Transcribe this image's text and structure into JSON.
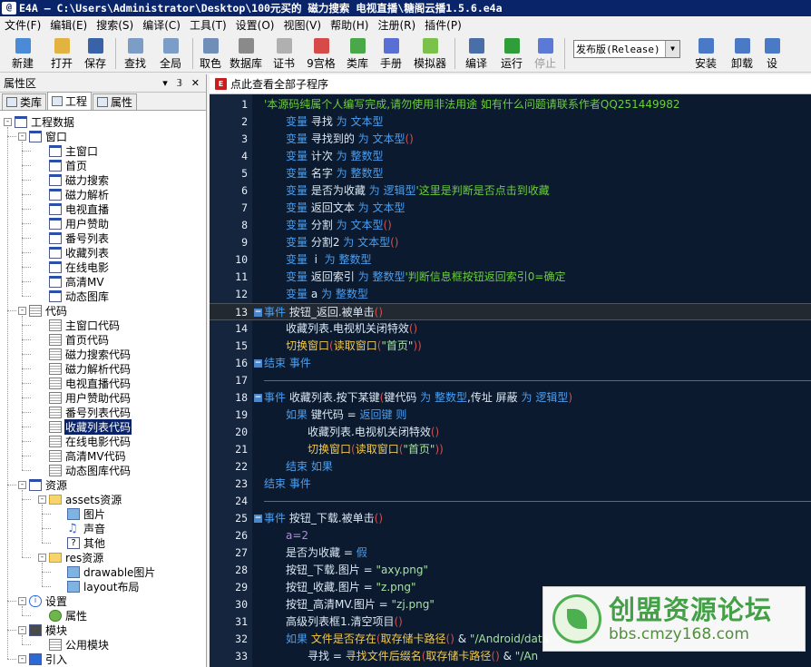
{
  "window": {
    "title": "E4A — C:\\Users\\Administrator\\Desktop\\100元买的 磁力搜索 电视直播\\糖阁云播1.5.6.e4a",
    "app_badge": "@"
  },
  "menu": [
    "文件(F)",
    "编辑(E)",
    "搜索(S)",
    "编译(C)",
    "工具(T)",
    "设置(O)",
    "视图(V)",
    "帮助(H)",
    "注册(R)",
    "插件(P)"
  ],
  "toolbar": {
    "buttons": [
      {
        "label": "新建",
        "icon": "new-file-icon",
        "color": "#4a8ad6"
      },
      {
        "label": "打开",
        "icon": "open-folder-icon",
        "color": "#e3b341"
      },
      {
        "label": "保存",
        "icon": "save-icon",
        "color": "#3a62a8"
      },
      {
        "label": "查找",
        "icon": "search-icon",
        "color": "#7c9ec6"
      },
      {
        "label": "全局",
        "icon": "global-search-icon",
        "color": "#7c9ec6"
      },
      {
        "label": "取色",
        "icon": "color-picker-icon",
        "color": "#6f8fb8"
      },
      {
        "label": "数据库",
        "icon": "database-icon",
        "color": "#8a8a8a"
      },
      {
        "label": "证书",
        "icon": "certificate-icon",
        "color": "#b0b0b0"
      },
      {
        "label": "9宫格",
        "icon": "nine-grid-icon",
        "color": "#d64a4a"
      },
      {
        "label": "类库",
        "icon": "library-icon",
        "color": "#4aa84a"
      },
      {
        "label": "手册",
        "icon": "manual-icon",
        "color": "#5a6fd6"
      },
      {
        "label": "模拟器",
        "icon": "android-icon",
        "color": "#7cc24a"
      },
      {
        "label": "编译",
        "icon": "compile-icon",
        "color": "#4a6fa8"
      },
      {
        "label": "运行",
        "icon": "run-icon",
        "color": "#2f9e3a"
      },
      {
        "label": "停止",
        "icon": "stop-icon",
        "color": "#5a7ad6",
        "disabled": true
      }
    ],
    "config_select": "发布版(Release)",
    "right_buttons": [
      {
        "label": "安装",
        "icon": "install-icon",
        "color": "#4a7ac6"
      },
      {
        "label": "卸载",
        "icon": "uninstall-icon",
        "color": "#4a7ac6"
      },
      {
        "label": "设",
        "icon": "settings-icon",
        "color": "#4a7ac6"
      }
    ]
  },
  "left_panel": {
    "title": "属性区",
    "header_controls": "▾ 𝟛 ✕",
    "tabs": [
      "类库",
      "工程",
      "属性"
    ],
    "tree": [
      {
        "label": "工程数据",
        "depth": 0,
        "icon": "project-icon",
        "expander": "-"
      },
      {
        "label": "窗口",
        "depth": 1,
        "icon": "window-icon",
        "expander": "-"
      },
      {
        "label": "主窗口",
        "depth": 2,
        "icon": "window-icon"
      },
      {
        "label": "首页",
        "depth": 2,
        "icon": "window-icon"
      },
      {
        "label": "磁力搜索",
        "depth": 2,
        "icon": "window-icon"
      },
      {
        "label": "磁力解析",
        "depth": 2,
        "icon": "window-icon"
      },
      {
        "label": "电视直播",
        "depth": 2,
        "icon": "window-icon"
      },
      {
        "label": "用户赞助",
        "depth": 2,
        "icon": "window-icon"
      },
      {
        "label": "番号列表",
        "depth": 2,
        "icon": "window-icon"
      },
      {
        "label": "收藏列表",
        "depth": 2,
        "icon": "window-icon"
      },
      {
        "label": "在线电影",
        "depth": 2,
        "icon": "window-icon"
      },
      {
        "label": "高清MV",
        "depth": 2,
        "icon": "window-icon"
      },
      {
        "label": "动态图库",
        "depth": 2,
        "icon": "window-icon"
      },
      {
        "label": "代码",
        "depth": 1,
        "icon": "code-icon",
        "expander": "-"
      },
      {
        "label": "主窗口代码",
        "depth": 2,
        "icon": "document-icon"
      },
      {
        "label": "首页代码",
        "depth": 2,
        "icon": "document-icon"
      },
      {
        "label": "磁力搜索代码",
        "depth": 2,
        "icon": "document-icon"
      },
      {
        "label": "磁力解析代码",
        "depth": 2,
        "icon": "document-icon"
      },
      {
        "label": "电视直播代码",
        "depth": 2,
        "icon": "document-icon"
      },
      {
        "label": "用户赞助代码",
        "depth": 2,
        "icon": "document-icon"
      },
      {
        "label": "番号列表代码",
        "depth": 2,
        "icon": "document-icon"
      },
      {
        "label": "收藏列表代码",
        "depth": 2,
        "icon": "document-icon",
        "selected": true
      },
      {
        "label": "在线电影代码",
        "depth": 2,
        "icon": "document-icon"
      },
      {
        "label": "高清MV代码",
        "depth": 2,
        "icon": "document-icon"
      },
      {
        "label": "动态图库代码",
        "depth": 2,
        "icon": "document-icon"
      },
      {
        "label": "资源",
        "depth": 1,
        "icon": "resource-icon",
        "expander": "-"
      },
      {
        "label": "assets资源",
        "depth": 2,
        "icon": "folder-icon",
        "expander": "-"
      },
      {
        "label": "图片",
        "depth": 3,
        "icon": "image-icon"
      },
      {
        "label": "声音",
        "depth": 3,
        "icon": "sound-icon"
      },
      {
        "label": "其他",
        "depth": 3,
        "icon": "question-icon"
      },
      {
        "label": "res资源",
        "depth": 2,
        "icon": "folder-icon",
        "expander": "-"
      },
      {
        "label": "drawable图片",
        "depth": 3,
        "icon": "image-icon"
      },
      {
        "label": "layout布局",
        "depth": 3,
        "icon": "layout-icon"
      },
      {
        "label": "设置",
        "depth": 1,
        "icon": "info-icon",
        "expander": "-"
      },
      {
        "label": "属性",
        "depth": 2,
        "icon": "gear-icon"
      },
      {
        "label": "模块",
        "depth": 1,
        "icon": "module-icon",
        "expander": "-"
      },
      {
        "label": "公用模块",
        "depth": 2,
        "icon": "document-icon"
      },
      {
        "label": "引入",
        "depth": 1,
        "icon": "import-icon",
        "expander": "-"
      }
    ]
  },
  "editor": {
    "link_text": "点此查看全部子程序",
    "lines": [
      {
        "n": "1",
        "indent": 0,
        "tokens": [
          [
            "c",
            "'本源码纯属个人编写完成,请勿使用非法用途 如有什么问题请联系作者QQ251449982"
          ]
        ]
      },
      {
        "n": "2",
        "indent": 1,
        "tokens": [
          [
            "k",
            "变量 "
          ],
          [
            "n",
            "寻找 "
          ],
          [
            "k",
            "为 "
          ],
          [
            "t",
            "文本型"
          ]
        ]
      },
      {
        "n": "3",
        "indent": 1,
        "tokens": [
          [
            "k",
            "变量 "
          ],
          [
            "n",
            "寻找到的 "
          ],
          [
            "k",
            "为 "
          ],
          [
            "t",
            "文本型"
          ],
          [
            "o",
            "()"
          ]
        ]
      },
      {
        "n": "4",
        "indent": 1,
        "tokens": [
          [
            "k",
            "变量 "
          ],
          [
            "n",
            "计次 "
          ],
          [
            "k",
            "为 "
          ],
          [
            "t",
            "整数型"
          ]
        ]
      },
      {
        "n": "5",
        "indent": 1,
        "tokens": [
          [
            "k",
            "变量 "
          ],
          [
            "n",
            "名字 "
          ],
          [
            "k",
            "为 "
          ],
          [
            "t",
            "整数型"
          ]
        ]
      },
      {
        "n": "6",
        "indent": 1,
        "tokens": [
          [
            "k",
            "变量 "
          ],
          [
            "n",
            "是否为收藏 "
          ],
          [
            "k",
            "为 "
          ],
          [
            "t",
            "逻辑型"
          ],
          [
            "c",
            "'这里是判断是否点击到收藏"
          ]
        ]
      },
      {
        "n": "7",
        "indent": 1,
        "tokens": [
          [
            "k",
            "变量 "
          ],
          [
            "n",
            "返回文本 "
          ],
          [
            "k",
            "为 "
          ],
          [
            "t",
            "文本型"
          ]
        ]
      },
      {
        "n": "8",
        "indent": 1,
        "tokens": [
          [
            "k",
            "变量 "
          ],
          [
            "n",
            "分割 "
          ],
          [
            "k",
            "为 "
          ],
          [
            "t",
            "文本型"
          ],
          [
            "o",
            "()"
          ]
        ]
      },
      {
        "n": "9",
        "indent": 1,
        "tokens": [
          [
            "k",
            "变量 "
          ],
          [
            "n",
            "分割2 "
          ],
          [
            "k",
            "为 "
          ],
          [
            "t",
            "文本型"
          ],
          [
            "o",
            "()"
          ]
        ]
      },
      {
        "n": "10",
        "indent": 1,
        "tokens": [
          [
            "k",
            "变量 "
          ],
          [
            "n",
            " i  "
          ],
          [
            "k",
            "为 "
          ],
          [
            "t",
            "整数型"
          ]
        ]
      },
      {
        "n": "11",
        "indent": 1,
        "tokens": [
          [
            "k",
            "变量 "
          ],
          [
            "n",
            "返回索引 "
          ],
          [
            "k",
            "为 "
          ],
          [
            "t",
            "整数型"
          ],
          [
            "c",
            "'判断信息框按钮返回索引0=确定"
          ]
        ]
      },
      {
        "n": "12",
        "indent": 1,
        "tokens": [
          [
            "k",
            "变量 "
          ],
          [
            "n",
            "a "
          ],
          [
            "k",
            "为 "
          ],
          [
            "t",
            "整数型"
          ]
        ]
      },
      {
        "n": "13",
        "indent": 0,
        "fold": "−",
        "highlight": true,
        "tokens": [
          [
            "k",
            "事件 "
          ],
          [
            "n",
            "按钮_返回.被单击"
          ],
          [
            "o",
            "()"
          ]
        ]
      },
      {
        "n": "14",
        "indent": 1,
        "tokens": [
          [
            "n",
            "收藏列表.电视机关闭特效"
          ],
          [
            "o",
            "()"
          ]
        ]
      },
      {
        "n": "15",
        "indent": 1,
        "tokens": [
          [
            "y",
            "切换窗口"
          ],
          [
            "o",
            "("
          ],
          [
            "y",
            "读取窗口"
          ],
          [
            "o",
            "("
          ],
          [
            "s",
            "\"首页\""
          ],
          [
            "o",
            "))"
          ]
        ]
      },
      {
        "n": "16",
        "indent": 0,
        "fold": "−",
        "tokens": [
          [
            "k",
            "结束 "
          ],
          [
            "k",
            "事件"
          ]
        ]
      },
      {
        "n": "17",
        "indent": 0,
        "separator": true,
        "tokens": []
      },
      {
        "n": "18",
        "indent": 0,
        "fold": "−",
        "tokens": [
          [
            "k",
            "事件 "
          ],
          [
            "n",
            "收藏列表.按下某键"
          ],
          [
            "o",
            "("
          ],
          [
            "n",
            "键代码 "
          ],
          [
            "k",
            "为 "
          ],
          [
            "t",
            "整数型"
          ],
          [
            "n",
            ",传址 "
          ],
          [
            "n",
            "屏蔽 "
          ],
          [
            "k",
            "为 "
          ],
          [
            "t",
            "逻辑型"
          ],
          [
            "o",
            ")"
          ]
        ]
      },
      {
        "n": "19",
        "indent": 1,
        "tokens": [
          [
            "k",
            "如果 "
          ],
          [
            "n",
            "键代码 = "
          ],
          [
            "k",
            "返回键 "
          ],
          [
            "k",
            "则"
          ]
        ]
      },
      {
        "n": "20",
        "indent": 2,
        "tokens": [
          [
            "n",
            "收藏列表.电视机关闭特效"
          ],
          [
            "o",
            "()"
          ]
        ]
      },
      {
        "n": "21",
        "indent": 2,
        "tokens": [
          [
            "y",
            "切换窗口"
          ],
          [
            "o",
            "("
          ],
          [
            "y",
            "读取窗口"
          ],
          [
            "o",
            "("
          ],
          [
            "s",
            "\"首页\""
          ],
          [
            "o",
            "))"
          ]
        ]
      },
      {
        "n": "22",
        "indent": 1,
        "tokens": [
          [
            "k",
            "结束 "
          ],
          [
            "k",
            "如果"
          ]
        ]
      },
      {
        "n": "23",
        "indent": 0,
        "tokens": [
          [
            "k",
            "结束 "
          ],
          [
            "k",
            "事件"
          ]
        ]
      },
      {
        "n": "24",
        "indent": 0,
        "separator": true,
        "tokens": []
      },
      {
        "n": "25",
        "indent": 0,
        "fold": "−",
        "tokens": [
          [
            "k",
            "事件 "
          ],
          [
            "n",
            "按钮_下载.被单击"
          ],
          [
            "o",
            "()"
          ]
        ]
      },
      {
        "n": "26",
        "indent": 1,
        "tokens": [
          [
            "p",
            "a=2"
          ]
        ]
      },
      {
        "n": "27",
        "indent": 1,
        "tokens": [
          [
            "n",
            "是否为收藏 = "
          ],
          [
            "k",
            "假"
          ]
        ]
      },
      {
        "n": "28",
        "indent": 1,
        "tokens": [
          [
            "n",
            "按钮_下载.图片 = "
          ],
          [
            "s",
            "\"axy.png\""
          ]
        ]
      },
      {
        "n": "29",
        "indent": 1,
        "tokens": [
          [
            "n",
            "按钮_收藏.图片 = "
          ],
          [
            "s",
            "\"z.png\""
          ]
        ]
      },
      {
        "n": "30",
        "indent": 1,
        "tokens": [
          [
            "n",
            "按钮_高清MV.图片 = "
          ],
          [
            "s",
            "\"zj.png\""
          ]
        ]
      },
      {
        "n": "31",
        "indent": 1,
        "tokens": [
          [
            "n",
            "高级列表框1.清空项目"
          ],
          [
            "o",
            "()"
          ]
        ]
      },
      {
        "n": "32",
        "indent": 1,
        "tokens": [
          [
            "k",
            "如果 "
          ],
          [
            "y",
            "文件是否存在"
          ],
          [
            "o",
            "("
          ],
          [
            "y",
            "取存储卡路径"
          ],
          [
            "o",
            "()"
          ],
          [
            "n",
            " & "
          ],
          [
            "s",
            "\"/Android/data"
          ]
        ]
      },
      {
        "n": "33",
        "indent": 2,
        "tokens": [
          [
            "n",
            "寻找 = "
          ],
          [
            "y",
            "寻找文件后缀名"
          ],
          [
            "o",
            "("
          ],
          [
            "y",
            "取存储卡路径"
          ],
          [
            "o",
            "()"
          ],
          [
            "n",
            " & "
          ],
          [
            "s",
            "\"/An"
          ]
        ]
      }
    ]
  },
  "watermark": {
    "main": "创盟资源论坛",
    "sub": "bbs.cmzy168.com"
  }
}
